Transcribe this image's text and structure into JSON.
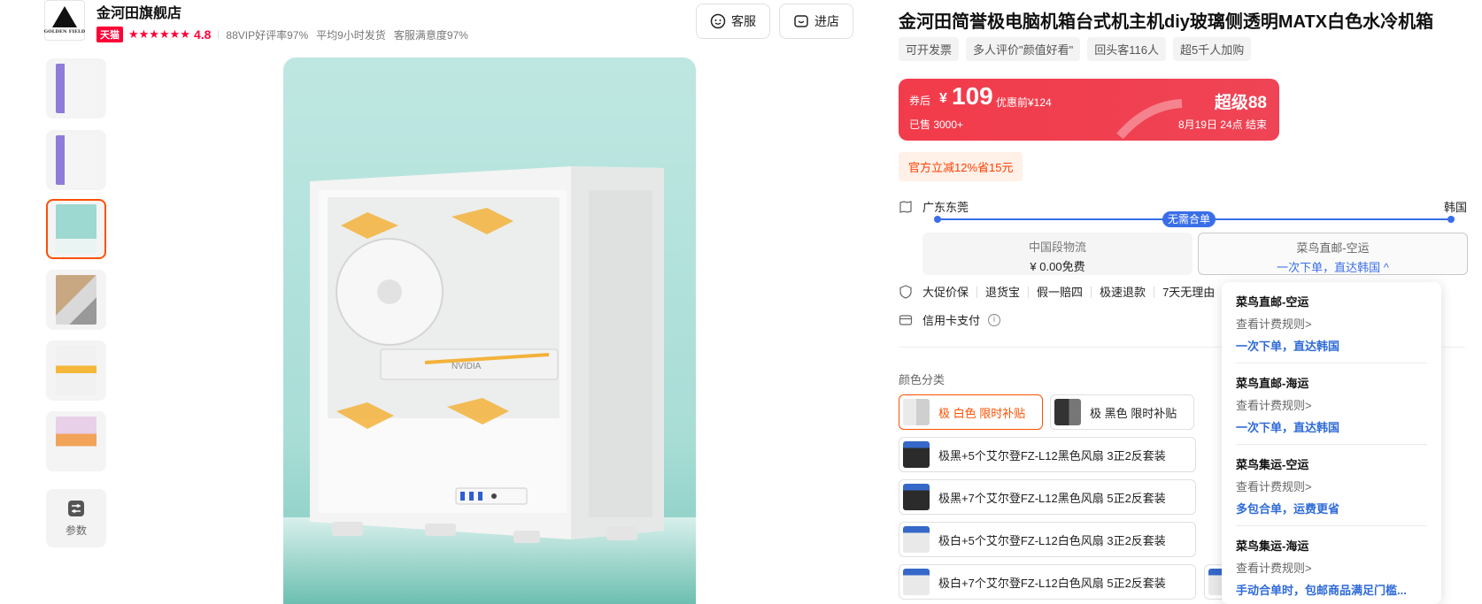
{
  "store": {
    "logo_text": "GOLDEN FIELD",
    "name": "金河田旗舰店",
    "badge": "天猫",
    "stars": "★★★★★★",
    "rating": "4.8",
    "meta": [
      "88VIP好评率97%",
      "平均9小时发货",
      "客服满意度97%"
    ]
  },
  "header_buttons": {
    "service": "客服",
    "shop": "进店"
  },
  "gallery": {
    "param_label": "参数",
    "thumbnails": [
      {
        "colors": [
          "#8f7bd9",
          "#f5f5f5"
        ]
      },
      {
        "colors": [
          "#8f7bd9",
          "#f5f5f5"
        ]
      },
      {
        "colors": [
          "#8fd6cc",
          "#f5f5f5"
        ]
      },
      {
        "colors": [
          "#c8a882",
          "#999999"
        ]
      },
      {
        "colors": [
          "#f4b73a",
          "#f1f1f1"
        ]
      },
      {
        "colors": [
          "#e7d0e8",
          "#f1a35a"
        ]
      }
    ],
    "active_index": 2,
    "main_image_gpu_text": "NVIDIA"
  },
  "product": {
    "title": "金河田简誉极电脑机箱台式机主机diy玻璃侧透明MATX白色水冷机箱",
    "tags": [
      "可开发票",
      "多人评价\"颜值好看\"",
      "回头客116人",
      "超5千人加购"
    ]
  },
  "price": {
    "after_coupon_label": "券后",
    "currency": "¥",
    "value": "109",
    "original": "优惠前¥124",
    "sold": "已售 3000+",
    "promo_brand": "超级88",
    "promo_date": "8月19日 24点 结束"
  },
  "discount": "官方立减12%省15元",
  "shipping": {
    "from": "广东东莞",
    "to": "韩国",
    "route_pill": "无需合单",
    "options": [
      {
        "name": "中国段物流",
        "detail": "¥ 0.00免费"
      },
      {
        "name": "菜鸟直邮-空运",
        "detail": "一次下单，直达韩国 ^"
      }
    ]
  },
  "services": [
    "大促价保",
    "退货宝",
    "假一赔四",
    "极速退款",
    "7天无理由"
  ],
  "credit": "信用卡支付",
  "colors": {
    "label": "颜色分类",
    "options": [
      {
        "label": "极 白色 限时补贴",
        "active": true
      },
      {
        "label": "极 黑色 限时补贴",
        "active": false
      },
      {
        "label": "极黑+5个艾尔登FZ-L12黑色风扇 3正2反套装",
        "active": false
      },
      {
        "label": "极黑+7个艾尔登FZ-L12黑色风扇 5正2反套装",
        "active": false
      },
      {
        "label": "极白+5个艾尔登FZ-L12白色风扇 3正2反套装",
        "active": false
      },
      {
        "label": "极白+7个艾尔登FZ-L12白色风扇 5正2反套装",
        "active": false
      }
    ]
  },
  "shipping_dropdown": [
    {
      "title": "菜鸟直邮-空运",
      "rule": "查看计费规则>",
      "desc": "一次下单，直达韩国"
    },
    {
      "title": "菜鸟直邮-海运",
      "rule": "查看计费规则>",
      "desc": "一次下单，直达韩国"
    },
    {
      "title": "菜鸟集运-空运",
      "rule": "查看计费规则>",
      "desc": "多包合单，运费更省"
    },
    {
      "title": "菜鸟集运-海运",
      "rule": "查看计费规则>",
      "desc": "手动合单时，包邮商品满足门槛..."
    }
  ],
  "theme": {
    "accent": "#ff5000",
    "price_red": "#f23b4b",
    "link_blue": "#3a6ee8",
    "tmall_red": "#ff0036"
  }
}
